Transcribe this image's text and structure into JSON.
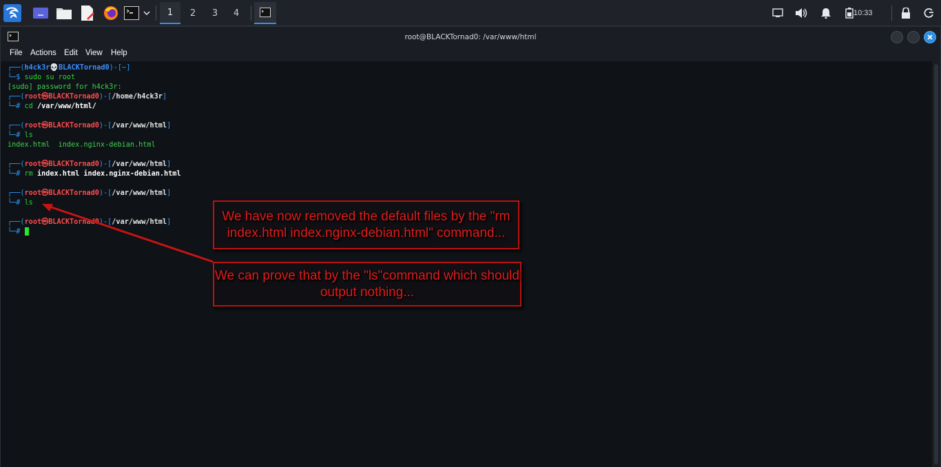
{
  "panel": {
    "workspaces": [
      "1",
      "2",
      "3",
      "4"
    ],
    "active_workspace": "1",
    "clock": "10:33",
    "icons": [
      "kali-menu-icon",
      "workspace-icon",
      "file-manager-icon",
      "text-editor-icon",
      "firefox-icon",
      "terminal-icon",
      "chevron-down-icon",
      "terminal-task-icon",
      "network-icon",
      "volume-icon",
      "notification-bell-icon",
      "battery-icon",
      "lock-icon",
      "power-icon"
    ]
  },
  "window": {
    "title": "root@BLACKTornad0: /var/www/html",
    "menu": [
      "File",
      "Actions",
      "Edit",
      "View",
      "Help"
    ]
  },
  "terminal": {
    "l1": {
      "frame": "┌──(",
      "user": "h4ck3r",
      "skull": "💀",
      "host": "BLACKTornad0",
      "tail": ")-[~]"
    },
    "l2": {
      "prompt": "└─$ ",
      "cmd": "sudo su root"
    },
    "l3": {
      "text": "[sudo] password for h4ck3r:"
    },
    "l4": {
      "frame": "┌──(",
      "user": "root",
      "at": "㉿",
      "host": "BLACKTornad0",
      "mid": ")-[",
      "path": "/home/h4ck3r",
      "end": "]"
    },
    "l5": {
      "prompt": "└─# ",
      "cmd": "cd",
      "arg": " /var/www/html/"
    },
    "l6": {
      "frame": "┌──(",
      "user": "root",
      "at": "㉿",
      "host": "BLACKTornad0",
      "mid": ")-[",
      "path": "/var/www/html",
      "end": "]"
    },
    "l7": {
      "prompt": "└─# ",
      "cmd": "ls"
    },
    "l8": {
      "text": "index.html  index.nginx-debian.html"
    },
    "l9": {
      "frame": "┌──(",
      "user": "root",
      "at": "㉿",
      "host": "BLACKTornad0",
      "mid": ")-[",
      "path": "/var/www/html",
      "end": "]"
    },
    "l10": {
      "prompt": "└─# ",
      "cmd": "rm",
      "arg": " index.html index.nginx-debian.html"
    },
    "l11": {
      "frame": "┌──(",
      "user": "root",
      "at": "㉿",
      "host": "BLACKTornad0",
      "mid": ")-[",
      "path": "/var/www/html",
      "end": "]"
    },
    "l12": {
      "prompt": "└─# ",
      "cmd": "ls"
    },
    "l13": {
      "frame": "┌──(",
      "user": "root",
      "at": "㉿",
      "host": "BLACKTornad0",
      "mid": ")-[",
      "path": "/var/www/html",
      "end": "]"
    },
    "l14": {
      "prompt": "└─# "
    }
  },
  "annotations": {
    "note1": "We have now removed the default files by the \"rm index.html index.nginx-debian.html\" command...",
    "note2": "We can prove that by the \"ls\"command which should output nothing..."
  },
  "colors": {
    "annotation": "#e31b1b",
    "prompt_frame": "#2d9bff",
    "root": "#ff4b4b",
    "command": "#2fd23a"
  }
}
